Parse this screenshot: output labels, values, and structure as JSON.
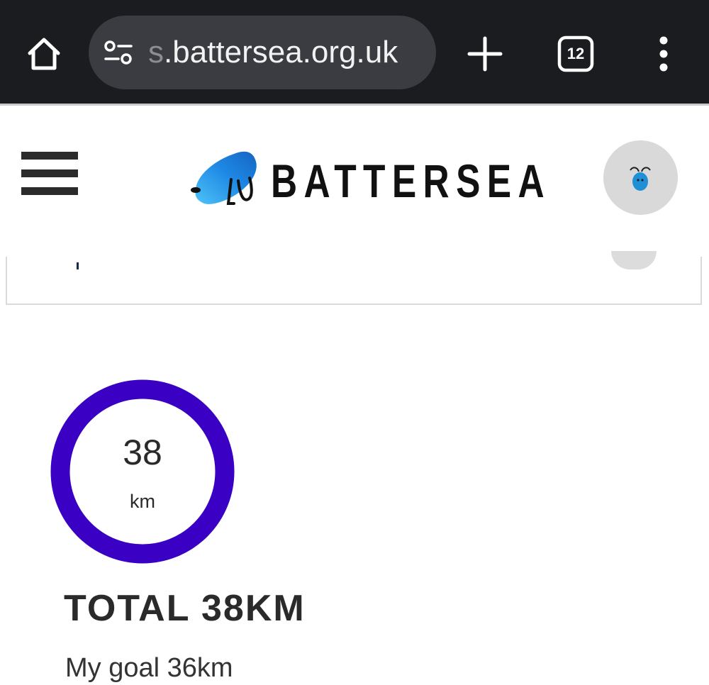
{
  "browser": {
    "url_faded": "s",
    "url_main": ".battersea.org.uk",
    "tab_count": "12"
  },
  "site": {
    "brand_name": "BATTERSEA",
    "brand_color": "#1f8fd6"
  },
  "progress": {
    "value": "38",
    "unit": "km",
    "heading": "TOTAL 38KM",
    "goal": "My goal 36km",
    "ring_color": "#3a00c4",
    "fraction_complete": 1.0
  },
  "icons": {
    "home": "home-icon",
    "site_info": "tune-icon",
    "new_tab": "plus-icon",
    "tabs": "tab-switcher-icon",
    "menu": "kebab-menu-icon",
    "hamburger": "hamburger-menu-icon",
    "account": "account-avatar-icon"
  }
}
